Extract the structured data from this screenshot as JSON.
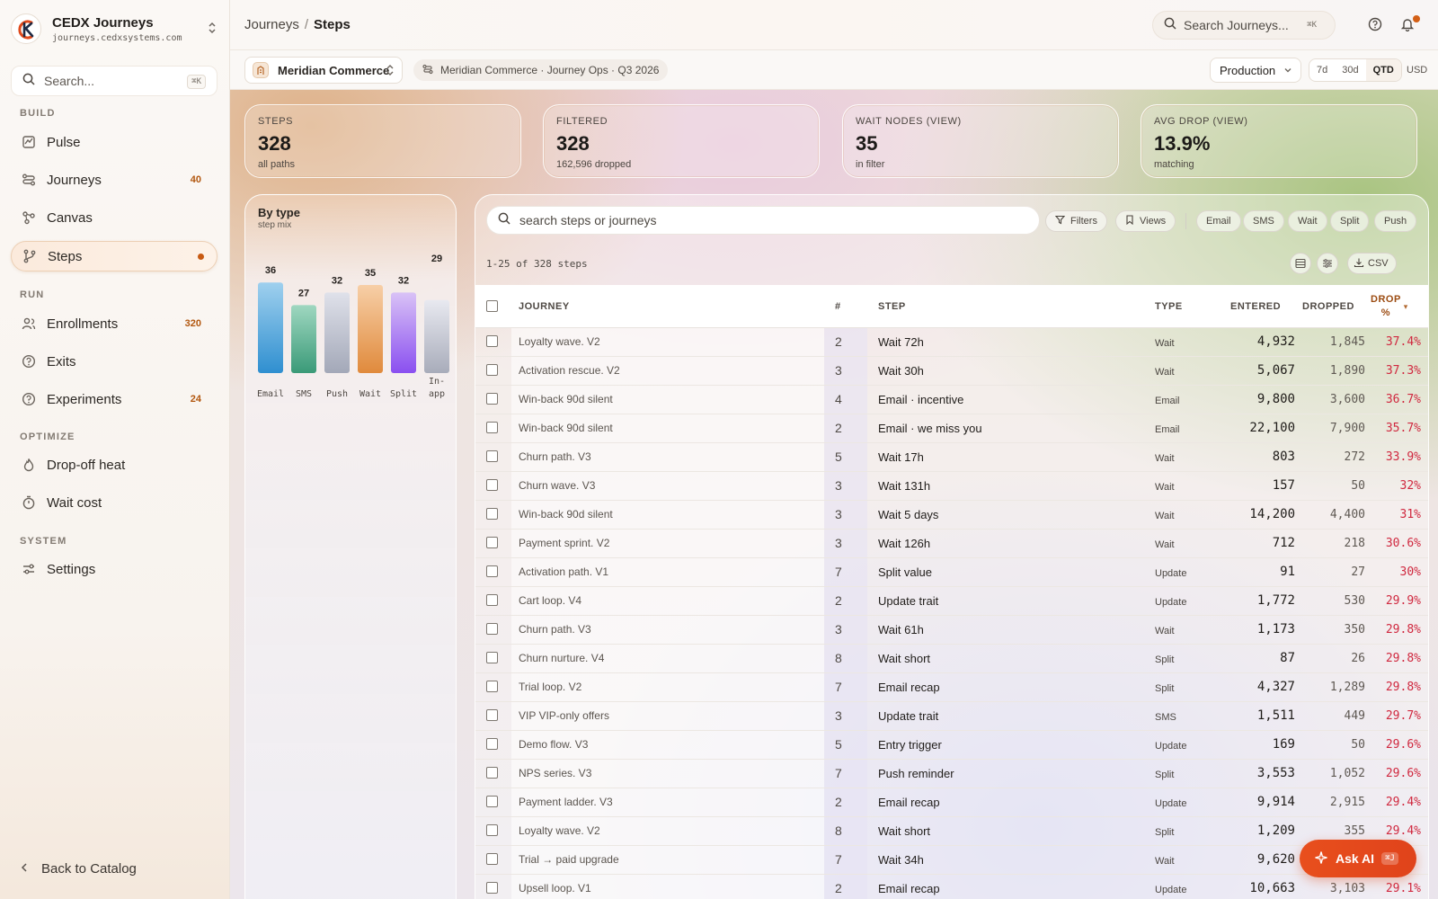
{
  "brand": {
    "name": "CEDX Journeys",
    "url": "journeys.cedxsystems.com"
  },
  "sidebar": {
    "search_placeholder": "Search...",
    "search_shortcut": "⌘K",
    "sections": {
      "build": "BUILD",
      "run": "RUN",
      "optimize": "OPTIMIZE",
      "system": "SYSTEM"
    },
    "items": [
      {
        "label": "Pulse",
        "icon": "pulse-icon"
      },
      {
        "label": "Journeys",
        "icon": "journeys-icon",
        "count": "40"
      },
      {
        "label": "Canvas",
        "icon": "canvas-icon"
      },
      {
        "label": "Steps",
        "icon": "steps-icon",
        "active": true
      },
      {
        "label": "Enrollments",
        "icon": "users-icon",
        "count": "320"
      },
      {
        "label": "Exits",
        "icon": "exit-icon"
      },
      {
        "label": "Experiments",
        "icon": "experiment-icon",
        "count": "24"
      },
      {
        "label": "Drop-off heat",
        "icon": "flame-icon"
      },
      {
        "label": "Wait cost",
        "icon": "timer-icon"
      },
      {
        "label": "Settings",
        "icon": "settings-icon"
      }
    ],
    "back_label": "Back to Catalog"
  },
  "topbar": {
    "breadcrumb_root": "Journeys",
    "breadcrumb_sep": "/",
    "breadcrumb_current": "Steps",
    "search_placeholder": "Search Journeys...",
    "search_shortcut": "⌘K"
  },
  "subbar": {
    "org": "Meridian Commerce",
    "context": "Meridian Commerce · Journey Ops · Q3 2026",
    "environment": "Production",
    "ranges": [
      "7d",
      "30d",
      "QTD"
    ],
    "active_range": "QTD",
    "currency": "USD"
  },
  "stats": [
    {
      "label": "STEPS",
      "value": "328",
      "sub": "all paths"
    },
    {
      "label": "FILTERED",
      "value": "328",
      "sub": "162,596 dropped"
    },
    {
      "label": "WAIT NODES (VIEW)",
      "value": "35",
      "sub": "in filter"
    },
    {
      "label": "AVG DROP (VIEW)",
      "value": "13.9%",
      "sub": "matching"
    }
  ],
  "by_type": {
    "title": "By type",
    "subtitle": "step mix",
    "colors": {
      "Email": [
        "#9fd0ee",
        "#2f8fd0"
      ],
      "SMS": [
        "#9fd7c0",
        "#3a9a78"
      ],
      "Push": [
        "#dfe1ea",
        "#a3a8b8"
      ],
      "Wait": [
        "#f7cfa7",
        "#e08a3c"
      ],
      "Split": [
        "#d9c2f6",
        "#8a4ff0"
      ],
      "In-app": [
        "#e8e9f0",
        "#a8acba"
      ]
    }
  },
  "chart_data": {
    "type": "bar",
    "title": "By type",
    "subtitle": "step mix",
    "categories": [
      "Email",
      "SMS",
      "Push",
      "Wait",
      "Split",
      "In-app"
    ],
    "values": [
      36,
      27,
      32,
      35,
      32,
      29
    ],
    "xlabel": "",
    "ylabel": "",
    "ylim": [
      0,
      40
    ],
    "grid": false
  },
  "table": {
    "search_placeholder": "search steps or journeys",
    "filters_label": "Filters",
    "views_label": "Views",
    "type_chips": [
      "Email",
      "SMS",
      "Wait",
      "Split",
      "Push"
    ],
    "count_text": "1-25 of 328 steps",
    "csv_label": "CSV",
    "columns": {
      "journey": "JOURNEY",
      "num": "#",
      "step": "STEP",
      "type": "TYPE",
      "entered": "ENTERED",
      "dropped": "DROPPED",
      "drop_pct_1": "DROP",
      "drop_pct_2": "%",
      "sort_mark": "▾"
    },
    "rows": [
      {
        "journey": "Loyalty wave. V2",
        "num": "2",
        "step": "Wait 72h",
        "type": "Wait",
        "entered": "4,932",
        "dropped": "1,845",
        "pct": "37.4%"
      },
      {
        "journey": "Activation rescue. V2",
        "num": "3",
        "step": "Wait 30h",
        "type": "Wait",
        "entered": "5,067",
        "dropped": "1,890",
        "pct": "37.3%"
      },
      {
        "journey": "Win-back 90d silent",
        "num": "4",
        "step": "Email · incentive",
        "type": "Email",
        "entered": "9,800",
        "dropped": "3,600",
        "pct": "36.7%"
      },
      {
        "journey": "Win-back 90d silent",
        "num": "2",
        "step": "Email · we miss you",
        "type": "Email",
        "entered": "22,100",
        "dropped": "7,900",
        "pct": "35.7%"
      },
      {
        "journey": "Churn path. V3",
        "num": "5",
        "step": "Wait 17h",
        "type": "Wait",
        "entered": "803",
        "dropped": "272",
        "pct": "33.9%"
      },
      {
        "journey": "Churn wave. V3",
        "num": "3",
        "step": "Wait 131h",
        "type": "Wait",
        "entered": "157",
        "dropped": "50",
        "pct": "32%"
      },
      {
        "journey": "Win-back 90d silent",
        "num": "3",
        "step": "Wait 5 days",
        "type": "Wait",
        "entered": "14,200",
        "dropped": "4,400",
        "pct": "31%"
      },
      {
        "journey": "Payment sprint. V2",
        "num": "3",
        "step": "Wait 126h",
        "type": "Wait",
        "entered": "712",
        "dropped": "218",
        "pct": "30.6%"
      },
      {
        "journey": "Activation path. V1",
        "num": "7",
        "step": "Split value",
        "type": "Update",
        "entered": "91",
        "dropped": "27",
        "pct": "30%"
      },
      {
        "journey": "Cart loop. V4",
        "num": "2",
        "step": "Update trait",
        "type": "Update",
        "entered": "1,772",
        "dropped": "530",
        "pct": "29.9%"
      },
      {
        "journey": "Churn path. V3",
        "num": "3",
        "step": "Wait 61h",
        "type": "Wait",
        "entered": "1,173",
        "dropped": "350",
        "pct": "29.8%"
      },
      {
        "journey": "Churn nurture. V4",
        "num": "8",
        "step": "Wait short",
        "type": "Split",
        "entered": "87",
        "dropped": "26",
        "pct": "29.8%"
      },
      {
        "journey": "Trial loop. V2",
        "num": "7",
        "step": "Email recap",
        "type": "Split",
        "entered": "4,327",
        "dropped": "1,289",
        "pct": "29.8%"
      },
      {
        "journey": "VIP VIP-only offers",
        "num": "3",
        "step": "Update trait",
        "type": "SMS",
        "entered": "1,511",
        "dropped": "449",
        "pct": "29.7%"
      },
      {
        "journey": "Demo flow. V3",
        "num": "5",
        "step": "Entry trigger",
        "type": "Update",
        "entered": "169",
        "dropped": "50",
        "pct": "29.6%"
      },
      {
        "journey": "NPS series. V3",
        "num": "7",
        "step": "Push reminder",
        "type": "Split",
        "entered": "3,553",
        "dropped": "1,052",
        "pct": "29.6%"
      },
      {
        "journey": "Payment ladder. V3",
        "num": "2",
        "step": "Email recap",
        "type": "Update",
        "entered": "9,914",
        "dropped": "2,915",
        "pct": "29.4%"
      },
      {
        "journey": "Loyalty wave. V2",
        "num": "8",
        "step": "Wait short",
        "type": "Split",
        "entered": "1,209",
        "dropped": "355",
        "pct": "29.4%"
      },
      {
        "journey": "Trial → paid upgrade",
        "num": "7",
        "step": "Wait 34h",
        "type": "Wait",
        "entered": "9,620",
        "dropped": "",
        "pct": ""
      },
      {
        "journey": "Upsell loop. V1",
        "num": "2",
        "step": "Email recap",
        "type": "Update",
        "entered": "10,663",
        "dropped": "3,103",
        "pct": "29.1%"
      }
    ]
  },
  "ask_ai": {
    "label": "Ask AI",
    "shortcut": "⌘J"
  },
  "accent": "#e0491b"
}
